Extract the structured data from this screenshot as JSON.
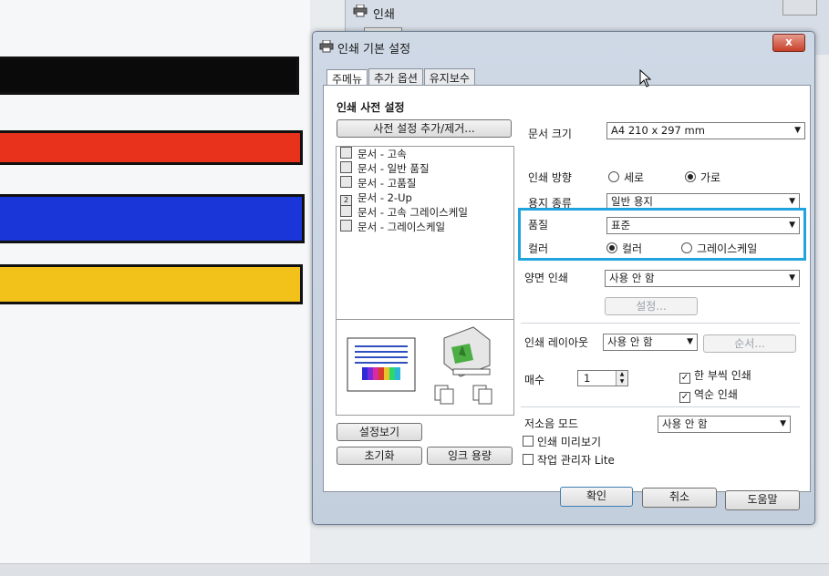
{
  "back_window": {
    "title": "인쇄"
  },
  "dialog": {
    "title": "인쇄 기본 설정",
    "close_label": "x",
    "tabs": [
      {
        "label": "주메뉴"
      },
      {
        "label": "추가 옵션"
      },
      {
        "label": "유지보수"
      }
    ]
  },
  "presets": {
    "title": "인쇄 사전 설정",
    "add_remove_label": "사전 설정 추가/제거...",
    "items": [
      {
        "label": "문서 - 고속",
        "icon": "document-icon"
      },
      {
        "label": "문서 - 일반 품질",
        "icon": "document-icon"
      },
      {
        "label": "문서 - 고품질",
        "icon": "document-icon"
      },
      {
        "label": "문서 - 2-Up",
        "icon": "two-up-icon"
      },
      {
        "label": "문서 - 고속 그레이스케일",
        "icon": "document-icon"
      },
      {
        "label": "문서 - 그레이스케일",
        "icon": "document-icon"
      }
    ]
  },
  "settings": {
    "paper_size_label": "문서 크기",
    "paper_size_value": "A4 210 x 297 mm",
    "orientation_label": "인쇄 방향",
    "orientation_portrait": "세로",
    "orientation_landscape": "가로",
    "orientation_selected": "landscape",
    "paper_type_label": "용지 종류",
    "paper_type_value": "일반 용지",
    "quality_label": "품질",
    "quality_value": "표준",
    "color_label": "컬러",
    "color_option": "컬러",
    "grayscale_option": "그레이스케일",
    "color_selected": "color",
    "duplex_label": "양면 인쇄",
    "duplex_value": "사용 안 함",
    "duplex_settings_label": "설정...",
    "layout_label": "인쇄 레이아웃",
    "layout_value": "사용 안 함",
    "layout_order_label": "순서...",
    "copies_label": "매수",
    "copies_value": "1",
    "collate_label": "한 부씩 인쇄",
    "collate_checked": true,
    "reverse_label": "역순 인쇄",
    "reverse_checked": true,
    "quiet_mode_label": "저소음 모드",
    "quiet_mode_value": "사용 안 함",
    "print_preview_label": "인쇄 미리보기",
    "print_preview_checked": false,
    "job_arranger_label": "작업 관리자 Lite",
    "job_arranger_checked": false
  },
  "left_buttons": {
    "show_settings": "설정보기",
    "reset": "초기화",
    "ink_levels": "잉크 용량"
  },
  "footer": {
    "ok": "확인",
    "cancel": "취소",
    "help": "도움말"
  },
  "colors": {
    "highlight": "#21a4dd",
    "stripe_black": "#0a0a0a",
    "stripe_red": "#e8321c",
    "stripe_blue": "#1a36d8",
    "stripe_yellow": "#f2c21a"
  }
}
